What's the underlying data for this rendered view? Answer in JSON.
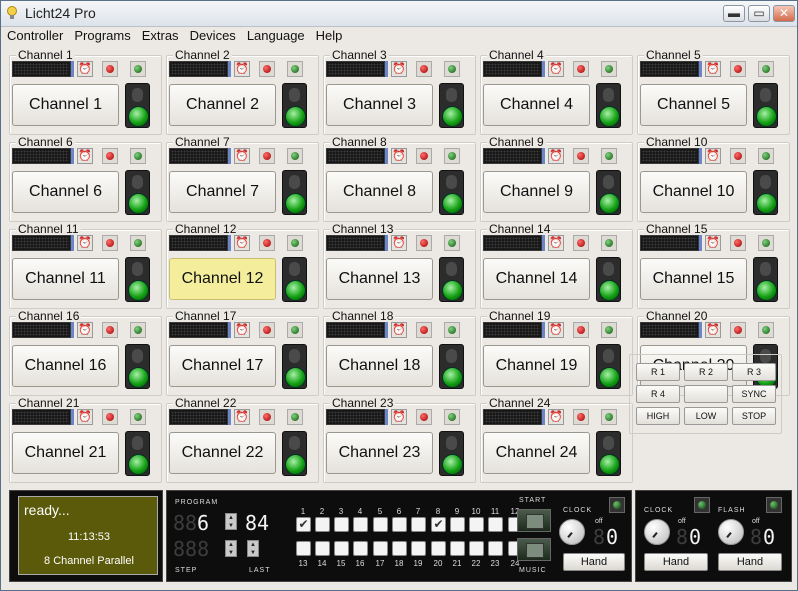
{
  "window": {
    "title": "Licht24 Pro",
    "min": "▬",
    "max": "▭",
    "close": "✕"
  },
  "menu": [
    "Controller",
    "Programs",
    "Extras",
    "Devices",
    "Language",
    "Help"
  ],
  "channels": [
    {
      "name": "Channel 1",
      "button": "Channel 1"
    },
    {
      "name": "Channel 2",
      "button": "Channel 2"
    },
    {
      "name": "Channel 3",
      "button": "Channel 3"
    },
    {
      "name": "Channel 4",
      "button": "Channel 4"
    },
    {
      "name": "Channel 5",
      "button": "Channel 5"
    },
    {
      "name": "Channel 6",
      "button": "Channel 6"
    },
    {
      "name": "Channel 7",
      "button": "Channel 7"
    },
    {
      "name": "Channel 8",
      "button": "Channel 8"
    },
    {
      "name": "Channel 9",
      "button": "Channel 9"
    },
    {
      "name": "Channel 10",
      "button": "Channel 10"
    },
    {
      "name": "Channel 11",
      "button": "Channel 11"
    },
    {
      "name": "Channel 12",
      "button": "Channel 12"
    },
    {
      "name": "Channel 13",
      "button": "Channel 13"
    },
    {
      "name": "Channel 14",
      "button": "Channel 14"
    },
    {
      "name": "Channel 15",
      "button": "Channel 15"
    },
    {
      "name": "Channel 16",
      "button": "Channel 16"
    },
    {
      "name": "Channel 17",
      "button": "Channel 17"
    },
    {
      "name": "Channel 18",
      "button": "Channel 18"
    },
    {
      "name": "Channel 19",
      "button": "Channel 19"
    },
    {
      "name": "Channel 20",
      "button": "Channel 20"
    },
    {
      "name": "Channel 21",
      "button": "Channel 21"
    },
    {
      "name": "Channel 22",
      "button": "Channel 22"
    },
    {
      "name": "Channel 23",
      "button": "Channel 23"
    },
    {
      "name": "Channel 24",
      "button": "Channel 24"
    }
  ],
  "highlighted_channel": 12,
  "control_buttons": [
    "R 1",
    "R 2",
    "R 3",
    "R 4",
    "",
    "SYNC",
    "HIGH",
    "LOW",
    "STOP"
  ],
  "status": {
    "text": "ready...",
    "time": "11:13:53",
    "mode": "8 Channel Parallel"
  },
  "program": {
    "program_label": "PROGRAM",
    "step_label": "STEP",
    "last_label": "LAST",
    "start_label": "START",
    "music_label": "MUSIC",
    "program_value": "6",
    "program_total": "84",
    "step_checks_top": [
      "1",
      "2",
      "3",
      "4",
      "5",
      "6",
      "7",
      "8",
      "9",
      "10",
      "11",
      "12"
    ],
    "step_checks_bottom": [
      "13",
      "14",
      "15",
      "16",
      "17",
      "18",
      "19",
      "20",
      "21",
      "22",
      "23",
      "24"
    ],
    "checked": [
      1,
      8
    ]
  },
  "clock_panel": {
    "label": "CLOCK",
    "off": "off",
    "hand": "Hand",
    "value": "0"
  },
  "flash_panel": {
    "clock_label": "CLOCK",
    "flash_label": "FLASH",
    "off": "off",
    "hand1": "Hand",
    "hand2": "Hand",
    "value": "0"
  },
  "colors": {
    "accent_green": "#13a113",
    "status_bg": "#5a5a0a",
    "highlight": "#f4ee9c"
  }
}
